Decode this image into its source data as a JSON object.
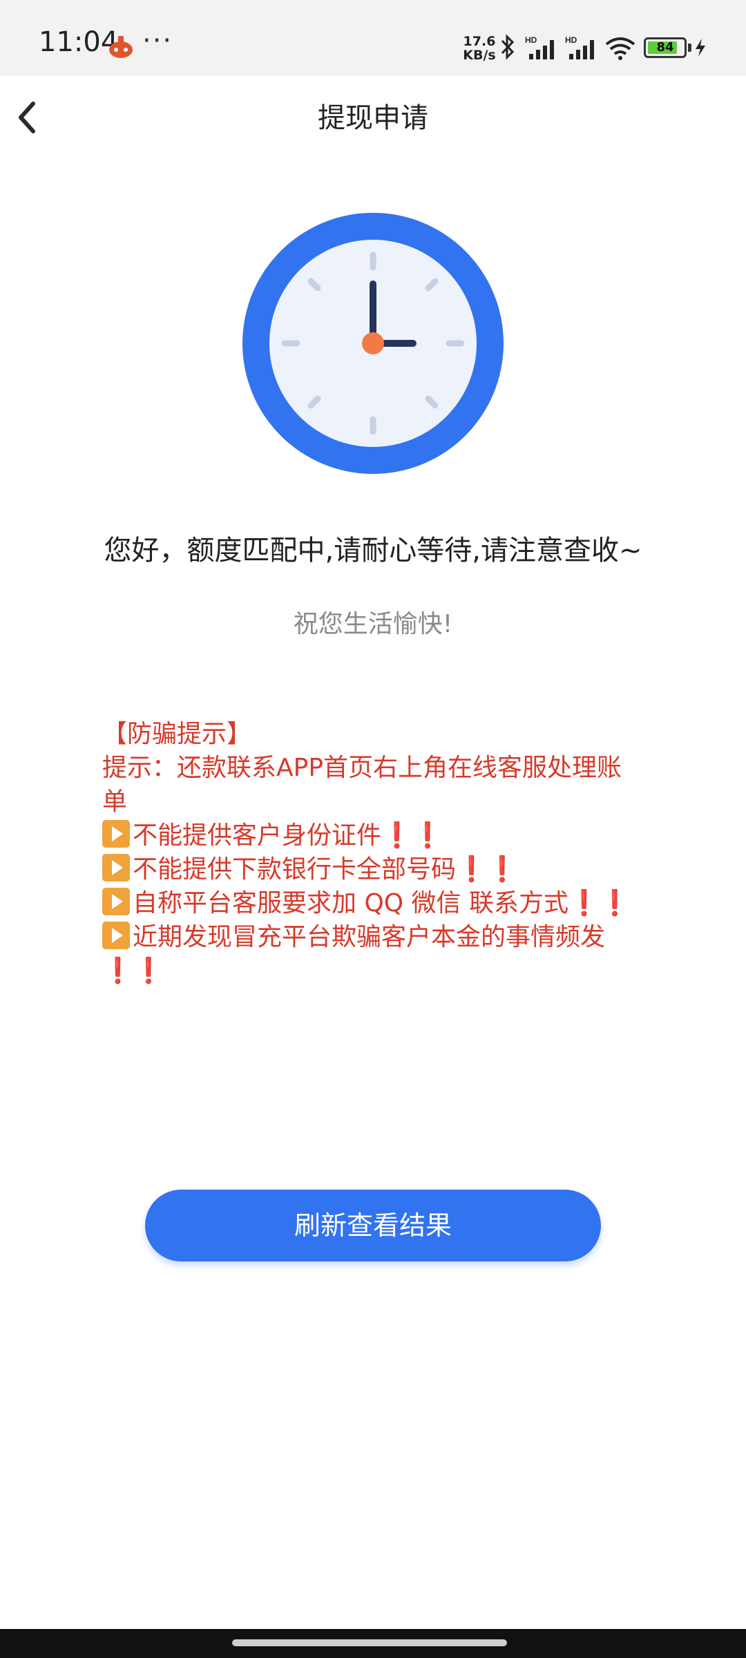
{
  "status_bar": {
    "time": "11:04",
    "dots": "···",
    "net_speed_value": "17.6",
    "net_speed_unit": "KB/s",
    "signal_1_label": "HD",
    "signal_2_label": "HD",
    "battery": "84",
    "battery_level": 0.84,
    "icons": [
      "app-notification-icon",
      "bluetooth-icon",
      "signal-icon",
      "wifi-icon",
      "battery-icon",
      "charging-icon"
    ]
  },
  "navbar": {
    "back_icon": "chevron-left-icon",
    "title": "提现申请"
  },
  "hero": {
    "icon": "clock-icon",
    "accent_color": "#3273f0"
  },
  "messages": {
    "main": "您好，额度匹配中,请耐心等待,请注意查收~",
    "sub": "祝您生活愉快!"
  },
  "notice": {
    "heading": "【防骗提示】",
    "tip": "提示：还款联系APP首页右上角在线客服处理账单",
    "items": [
      {
        "text": "不能提供客户身份证件",
        "suffix": "❗❗"
      },
      {
        "text": "不能提供下款银行卡全部号码",
        "suffix": "❗❗"
      },
      {
        "text": "自称平台客服要求加 QQ 微信  联系方式",
        "suffix": "❗❗"
      },
      {
        "text": "近期发现冒充平台欺骗客户本金的事情频发",
        "suffix": "❗❗"
      }
    ],
    "color": "#d83a2a"
  },
  "actions": {
    "refresh_label": "刷新查看结果",
    "button_color": "#3273f0"
  }
}
